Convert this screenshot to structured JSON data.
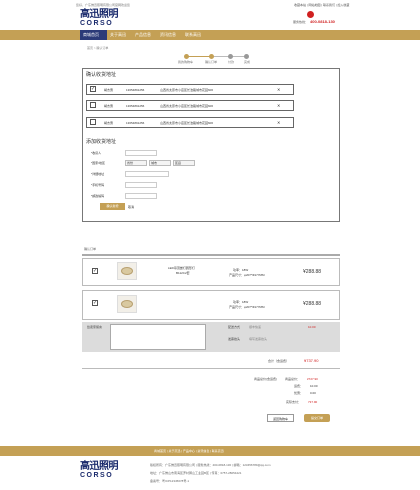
{
  "topbar": {
    "left_text": "您好，广东佛迅照明有限公司官网欢迎您",
    "right_links": [
      "收藏本站",
      "网站地图",
      "联系我们",
      "加入收藏"
    ],
    "logo_cn": "高迅照明",
    "logo_en": "CORSO",
    "hotline_label": "服务热线：",
    "hotline": "400-0818-130"
  },
  "nav": {
    "items": [
      "商城首页",
      "关于高迅",
      "产品信息",
      "资讯信息",
      "联系高迅"
    ]
  },
  "breadcrumb": "首页 > 确认订单",
  "steps": [
    "我的购物车",
    "确认订单",
    "付款",
    "完成"
  ],
  "address_section": {
    "title": "确认收货地址",
    "addresses": [
      {
        "checked": true,
        "name": "胡杰惠",
        "phone": "13654891256",
        "address": "山西省太原市小店区长治路城市花园606",
        "check": "✓",
        "close": "✕"
      },
      {
        "checked": false,
        "name": "胡杰惠",
        "phone": "13654891256",
        "address": "山西省太原市小店区长治路城市花园606",
        "check": "",
        "close": "✕"
      },
      {
        "checked": false,
        "name": "胡杰惠",
        "phone": "13654891256",
        "address": "山西省太原市小店区长治路城市花园606",
        "check": "",
        "close": "✕"
      }
    ],
    "new_title": "添加收货地址",
    "form_labels": [
      "*收货人",
      "*国家/地区",
      "*详细地址",
      "*手机号码",
      "*邮政编码"
    ],
    "select_labels": [
      "省份",
      "城市",
      "区县"
    ],
    "confirm_button": "确认新增",
    "cancel_link": "取消"
  },
  "order": {
    "section_label": "确认订单",
    "items": [
      {
        "checked": true,
        "check": "✓",
        "name": "LED吊顶嵌灯圆形灯",
        "model": "B112C2套",
        "power": "功率：18W",
        "spec": "产品尺寸：φ207*Φ177MM",
        "price": "¥288.88"
      },
      {
        "checked": true,
        "check": "✓",
        "name": "",
        "model": "",
        "power": "功率：18W",
        "spec": "产品尺寸：φ207*Φ177MM",
        "price": "¥288.88"
      }
    ],
    "remark_label": "给卖家留言",
    "shipping_label": "配送方式",
    "shipping_value": "顺丰快递",
    "shipping_fee": "10.00",
    "invoice_label": "发票抬头",
    "invoice_value": "填写发票抬头",
    "total_label": "合计（含运费）",
    "total": "¥737.90",
    "summary": [
      {
        "label": "商品总价：",
        "value": "¥727.90"
      },
      {
        "label": "运费：",
        "value": "10.00"
      },
      {
        "label": "优惠：",
        "value": "0.00"
      },
      {
        "label": "实际支付：",
        "value": "737.90"
      }
    ],
    "summary_left": "商品总价(含运费)",
    "back_button": "返回购物车",
    "submit_button": "提交订单"
  },
  "footer": {
    "links": "商城首页 | 关于高迅 | 产品中心 | 资讯信息 | 联系高迅",
    "logo_cn": "高迅照明",
    "logo_en": "CORSO",
    "lines": [
      "版权所有：广东佛迅照明有限公司 | 服务热线：400-0818-130 | 邮箱：123456789@qq.com",
      "地址：广东佛山市南海区罗村狮山工业园B区 | 传真：0757-28054221",
      "备案号：粤ICP12345678号-1"
    ]
  },
  "colors": {
    "accent": "#c4a055",
    "nav_bg": "#c4a055",
    "price": "#333333",
    "red": "#d02020"
  }
}
